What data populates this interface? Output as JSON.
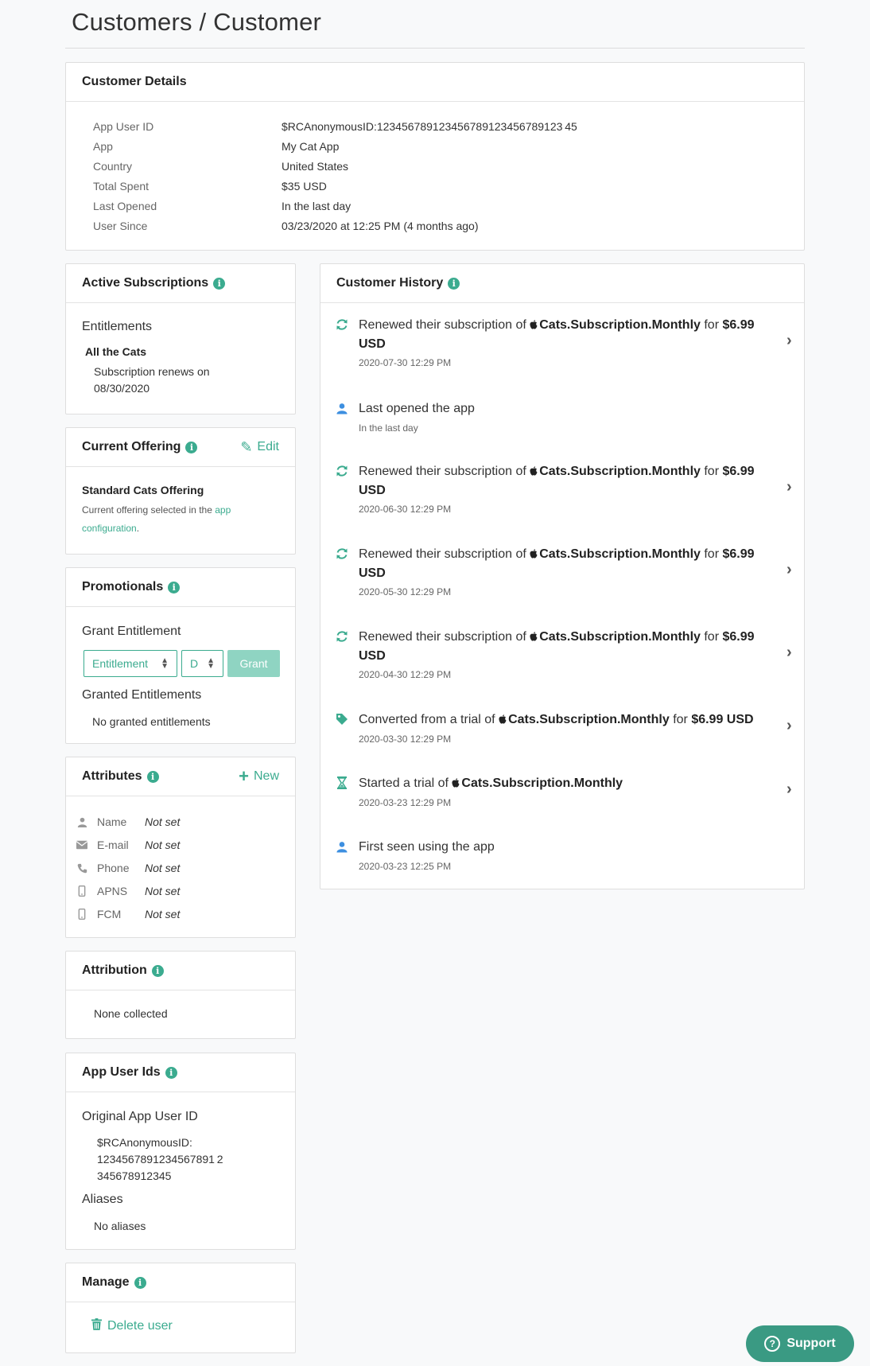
{
  "breadcrumb": "Customers / Customer",
  "customer_details": {
    "title": "Customer Details",
    "rows": [
      {
        "label": "App User ID",
        "value": "$RCAnonymousID:123456789123456789123456789123 45"
      },
      {
        "label": "App",
        "value": "My Cat App"
      },
      {
        "label": "Country",
        "value": "United States"
      },
      {
        "label": "Total Spent",
        "value": "$35 USD"
      },
      {
        "label": "Last Opened",
        "value": "In the last day"
      },
      {
        "label": "User Since",
        "value": "03/23/2020 at 12:25 PM (4 months ago)"
      }
    ]
  },
  "active_subscriptions": {
    "title": "Active Subscriptions",
    "entitlements_heading": "Entitlements",
    "entitlement_name": "All the Cats",
    "renew_text": "Subscription renews on 08/30/2020"
  },
  "current_offering": {
    "title": "Current Offering",
    "edit_label": "Edit",
    "offering_name": "Standard Cats Offering",
    "description_prefix": "Current offering selected in the ",
    "description_link": "app configuration",
    "description_suffix": "."
  },
  "promotionals": {
    "title": "Promotionals",
    "grant_heading": "Grant Entitlement",
    "entitlement_select": "Entitlement",
    "duration_select": "D",
    "grant_button": "Grant",
    "granted_heading": "Granted Entitlements",
    "granted_empty": "No granted entitlements"
  },
  "attributes": {
    "title": "Attributes",
    "new_label": "New",
    "rows": [
      {
        "icon": "user-icon",
        "name": "Name",
        "value": "Not set"
      },
      {
        "icon": "envelope-icon",
        "name": "E-mail",
        "value": "Not set"
      },
      {
        "icon": "phone-icon",
        "name": "Phone",
        "value": "Not set"
      },
      {
        "icon": "mobile-icon",
        "name": "APNS",
        "value": "Not set"
      },
      {
        "icon": "mobile-icon",
        "name": "FCM",
        "value": "Not set"
      }
    ]
  },
  "attribution": {
    "title": "Attribution",
    "empty": "None collected"
  },
  "app_user_ids": {
    "title": "App User Ids",
    "original_heading": "Original App User ID",
    "original_line1": "$RCAnonymousID:",
    "original_line2": "1234567891234567891 2",
    "original_line3": "345678912345",
    "aliases_heading": "Aliases",
    "aliases_empty": "No aliases"
  },
  "manage": {
    "title": "Manage",
    "delete_label": "Delete user"
  },
  "customer_history": {
    "title": "Customer History",
    "items": [
      {
        "icon": "refresh-icon",
        "pre": "Renewed their subscription of ",
        "product": "Cats.Subscription.Monthly",
        "mid": " for ",
        "amount": "$6.99",
        "line2": "USD",
        "time": "2020-07-30 12:29 PM",
        "chevron": true
      },
      {
        "icon": "user-icon",
        "pre": "Last opened the app",
        "time": "In the last day",
        "chevron": false
      },
      {
        "icon": "refresh-icon",
        "pre": "Renewed their subscription of ",
        "product": "Cats.Subscription.Monthly",
        "mid": " for ",
        "amount": "$6.99",
        "line2": "USD",
        "time": "2020-06-30 12:29 PM",
        "chevron": true
      },
      {
        "icon": "refresh-icon",
        "pre": "Renewed their subscription of ",
        "product": "Cats.Subscription.Monthly",
        "mid": " for ",
        "amount": "$6.99",
        "line2": "USD",
        "time": "2020-05-30 12:29 PM",
        "chevron": true
      },
      {
        "icon": "refresh-icon",
        "pre": "Renewed their subscription of ",
        "product": "Cats.Subscription.Monthly",
        "mid": " for ",
        "amount": "$6.99",
        "line2": "USD",
        "time": "2020-04-30 12:29 PM",
        "chevron": true
      },
      {
        "icon": "tag-icon",
        "pre": "Converted from a trial of ",
        "product": "Cats.Subscription.Monthly",
        "mid": " for ",
        "amount": "$6.99 USD",
        "time": "2020-03-30 12:29 PM",
        "chevron": true
      },
      {
        "icon": "hourglass-icon",
        "pre": "Started a trial of ",
        "product": "Cats.Subscription.Monthly",
        "time": "2020-03-23 12:29 PM",
        "chevron": true
      },
      {
        "icon": "user-icon",
        "pre": "First seen using the app",
        "time": "2020-03-23 12:25 PM",
        "chevron": false
      }
    ]
  },
  "support_button": "Support",
  "colors": {
    "accent": "#3bab8f",
    "icon_blue": "#3d8fe0"
  }
}
